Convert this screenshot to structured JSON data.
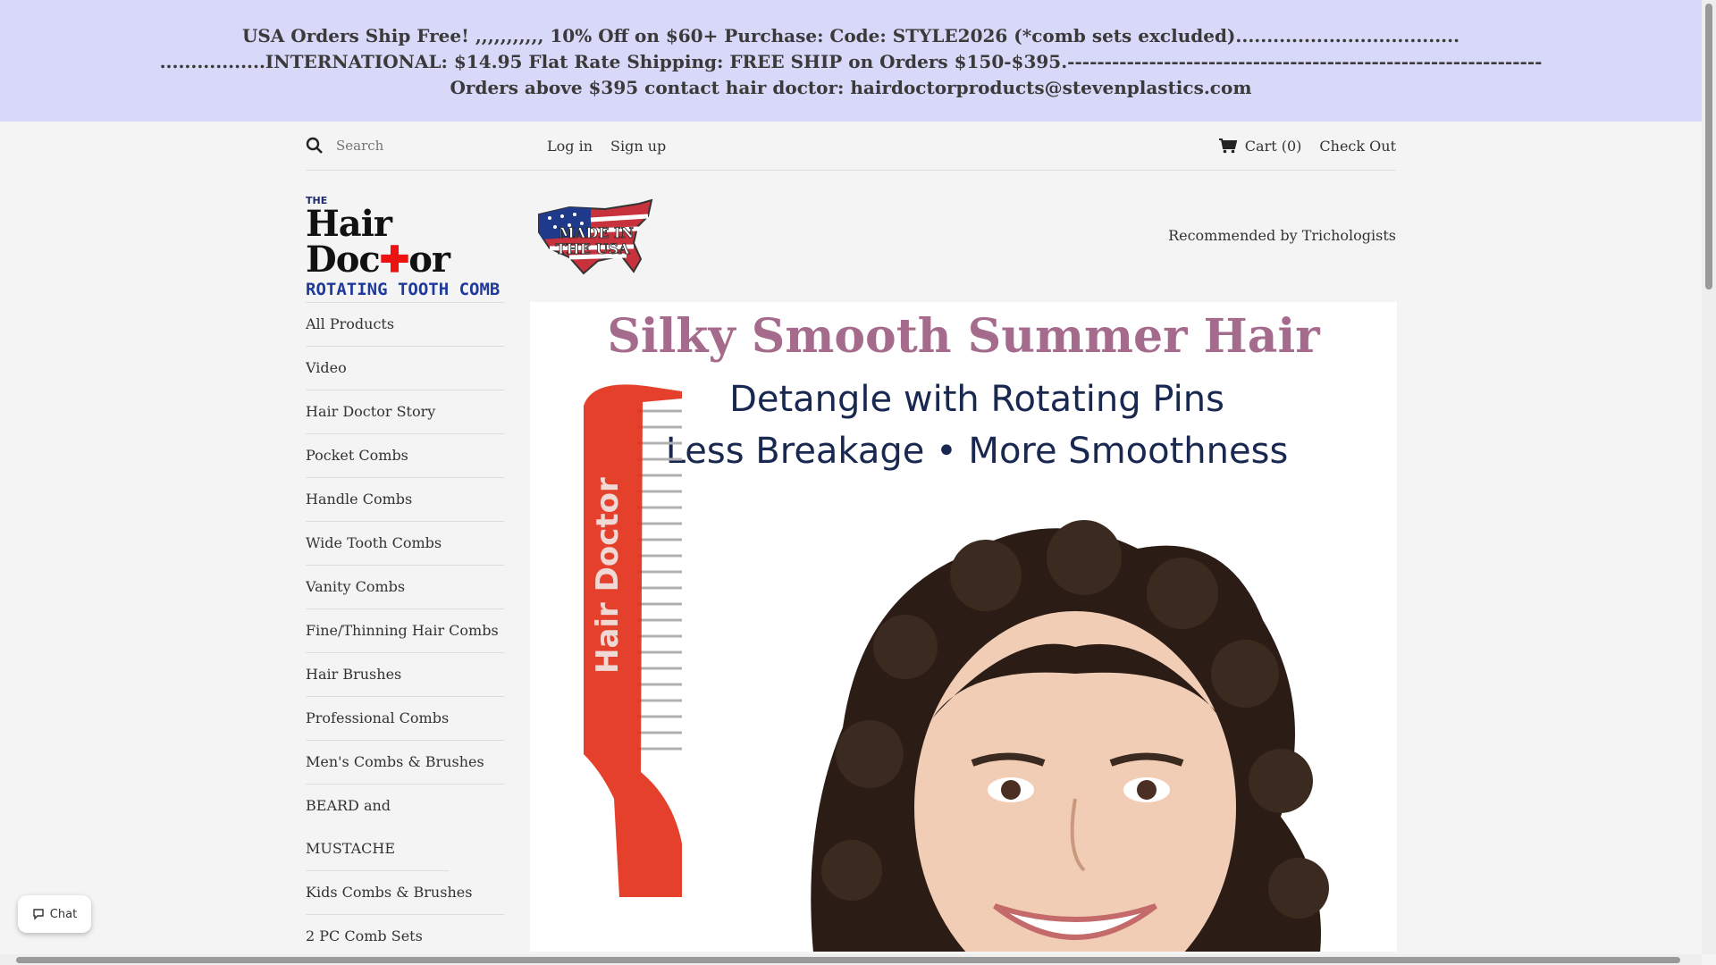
{
  "banner": {
    "line1": "USA Orders Ship Free! ,,,,,,,,,,, 10% Off on $60+ Purchase: Code: STYLE2026 (*comb sets excluded)....................................",
    "line2": ".................INTERNATIONAL: $14.95 Flat Rate Shipping: FREE SHIP on Orders $150-$395.----------------------------------------------------------------",
    "line3": "Orders above $395 contact hair doctor: hairdoctorproducts@stevenplastics.com"
  },
  "topbar": {
    "search_placeholder": "Search",
    "login": "Log in",
    "signup": "Sign up",
    "cart": "Cart (0)",
    "checkout": "Check Out"
  },
  "header": {
    "logo_the": "THE",
    "logo_name_a": "Hair Doc",
    "logo_name_b": "or",
    "logo_sub": "ROTATING TOOTH COMB",
    "usa_badge_line1": "MADE IN",
    "usa_badge_line2": "THE USA",
    "tagline": "Recommended by Trichologists"
  },
  "sidebar": {
    "items": [
      "All Products",
      "Video",
      "Hair Doctor Story",
      "Pocket Combs",
      "Handle Combs",
      "Wide Tooth Combs",
      "Vanity Combs",
      "Fine/Thinning Hair Combs",
      "Hair Brushes",
      "Professional Combs",
      "Men's Combs & Brushes",
      "BEARD and MUSTACHE Combs",
      "Kids Combs & Brushes",
      "2 PC Comb Sets"
    ]
  },
  "hero": {
    "headline": "Silky Smooth Summer Hair",
    "sub1": "Detangle with Rotating Pins",
    "sub2": "Less Breakage • More Smoothness",
    "comb_text": "Hair Doctor"
  },
  "chat": {
    "label": "Chat"
  },
  "colors": {
    "banner_bg": "#d8d8f8",
    "headline": "#a56b8c",
    "subhead": "#182850",
    "comb": "#e2301a"
  }
}
